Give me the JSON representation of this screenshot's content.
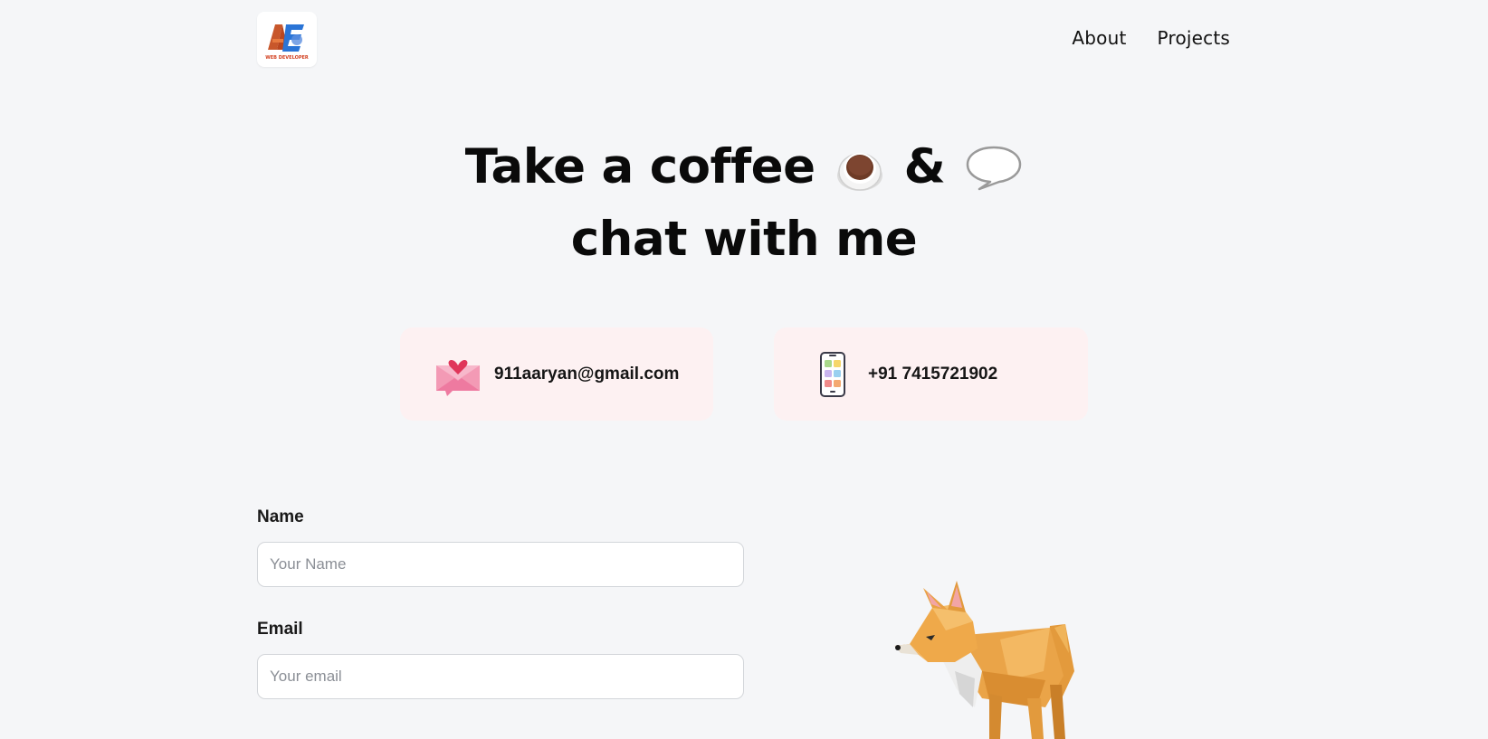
{
  "header": {
    "logo_text": "AE",
    "logo_subtext": "WEB DEVELOPER",
    "nav": [
      {
        "label": "About"
      },
      {
        "label": "Projects"
      }
    ]
  },
  "hero": {
    "line1_text": "Take a coffee",
    "line1_amp": "&",
    "line2": "chat with me",
    "icons": [
      "coffee-icon",
      "speech-bubble-icon"
    ]
  },
  "contacts": {
    "email": {
      "icon": "love-letter-icon",
      "text": "911aaryan@gmail.com"
    },
    "phone": {
      "icon": "mobile-phone-icon",
      "text": "+91 7415721902"
    }
  },
  "form": {
    "name": {
      "label": "Name",
      "placeholder": "Your Name",
      "value": ""
    },
    "email": {
      "label": "Email",
      "placeholder": "Your email",
      "value": ""
    }
  },
  "colors": {
    "background": "#f5f6f8",
    "card_bg": "#fdf1f2",
    "accent_orange": "#e8a24a"
  }
}
